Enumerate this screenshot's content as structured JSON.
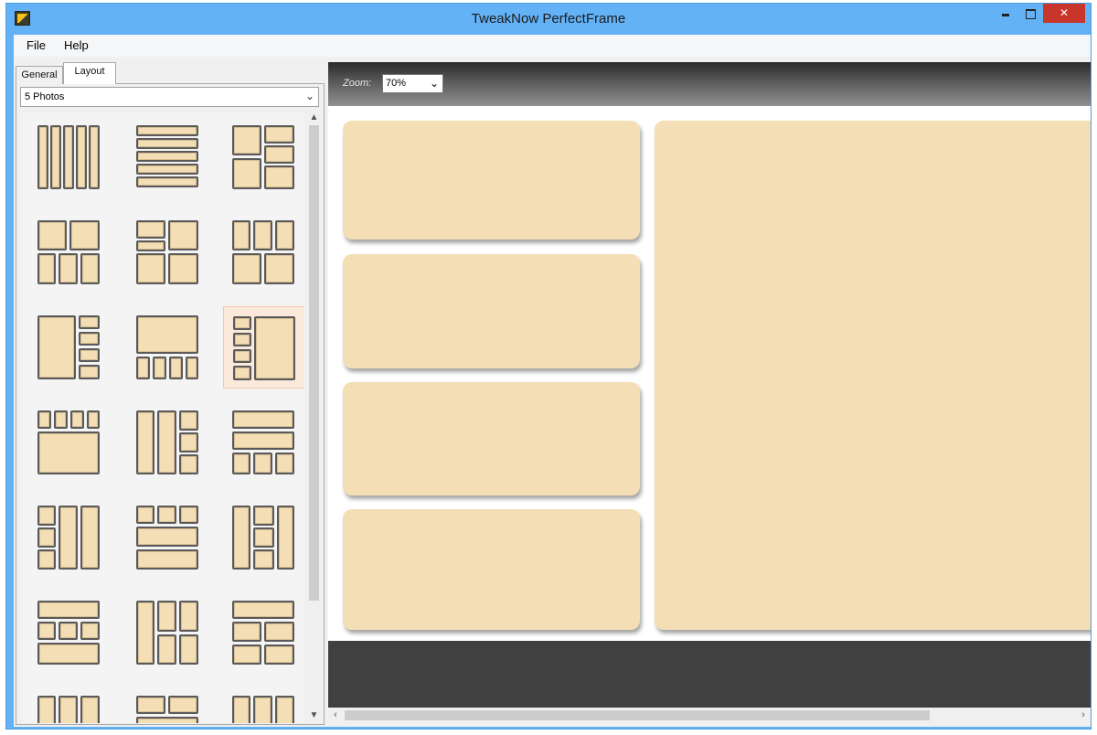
{
  "window": {
    "title": "TweakNow PerfectFrame"
  },
  "menu": {
    "file": "File",
    "help": "Help"
  },
  "tabs": {
    "general": "General",
    "layout": "Layout"
  },
  "photo_count": {
    "selected": "5 Photos"
  },
  "zoom": {
    "label": "Zoom:",
    "value": "70%"
  },
  "icons": {
    "app": "app-icon",
    "dropdown": "chevron-down-icon",
    "scroll_up": "scroll-up-icon",
    "scroll_down": "scroll-down-icon",
    "scroll_left": "scroll-left-icon",
    "scroll_right": "scroll-right-icon"
  },
  "colors": {
    "titlebar": "#63b2f6",
    "close_button": "#c7352b",
    "photo_fill": "#f4deb5",
    "thumb_selected": "#fbe9dc",
    "toolbar_dark": "#404040"
  },
  "layouts": {
    "count_visible": 21,
    "selected_index": 8
  }
}
